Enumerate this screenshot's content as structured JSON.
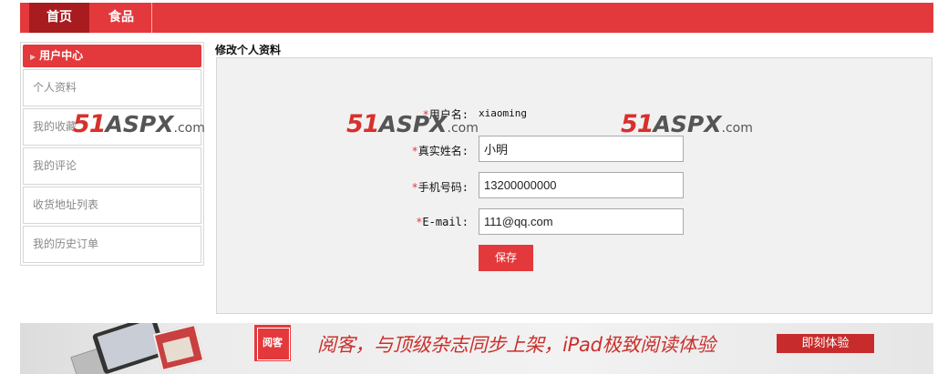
{
  "nav": {
    "tabs": [
      {
        "label": "首页",
        "active": true
      },
      {
        "label": "食品",
        "active": false
      }
    ],
    "accent": "#e4393c"
  },
  "sidebar": {
    "header": "用户中心",
    "items": [
      {
        "label": "个人资料"
      },
      {
        "label": "我的收藏"
      },
      {
        "label": "我的评论"
      },
      {
        "label": "收货地址列表"
      },
      {
        "label": "我的历史订单"
      }
    ]
  },
  "main": {
    "title": "修改个人资料",
    "form": {
      "required_mark": "*",
      "username": {
        "label": "用户名:",
        "value": "xiaoming"
      },
      "realname": {
        "label": "真实姓名:",
        "value": "小明"
      },
      "phone": {
        "label": "手机号码:",
        "value": "13200000000"
      },
      "email": {
        "label": "E-mail:",
        "value": "111@qq.com"
      },
      "save_label": "保存"
    }
  },
  "watermark": {
    "num": "51",
    "brand": "ASPX",
    "suffix": ".com"
  },
  "banner": {
    "logo_text": "阅客",
    "slogan": "阅客，与顶级杂志同步上架，iPad极致阅读体验",
    "cta_label": "即刻体验"
  }
}
